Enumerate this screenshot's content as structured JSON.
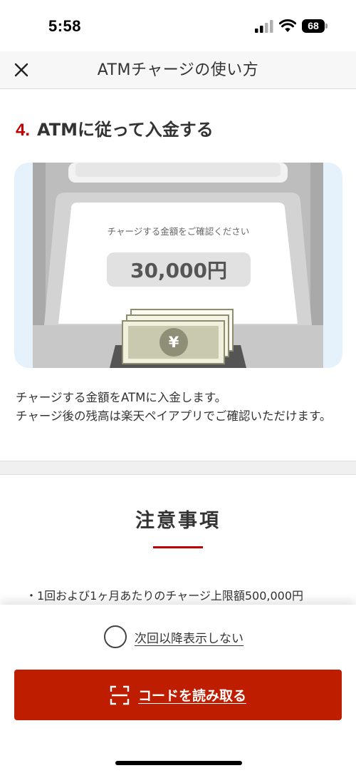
{
  "status_bar": {
    "time": "5:58",
    "battery": "68",
    "icons": [
      "signal-icon",
      "wifi-icon",
      "battery-icon"
    ]
  },
  "nav": {
    "title": "ATMチャージの使い方",
    "close_icon": "close-icon"
  },
  "step": {
    "number": "4.",
    "title": "ATMに従って入金する"
  },
  "illustration": {
    "screen_caption": "チャージする金額をご確認ください",
    "amount": "30,000円",
    "banknote_symbol": "¥"
  },
  "description": {
    "line1": "チャージする金額をATMに入金します。",
    "line2": "チャージ後の残高は楽天ペイアプリでご確認いただけます。"
  },
  "notes": {
    "heading": "注意事項",
    "items": [
      "・1回および1ヶ月あたりのチャージ上限額500,000円"
    ]
  },
  "bottom_sheet": {
    "dont_show_label": "次回以降表示しない",
    "scan_button_label": "コードを読み取る",
    "scan_icon": "scan-frame-icon"
  },
  "colors": {
    "accent": "#bf0000",
    "button": "#bf1d00",
    "illustration_bg": "#e6f2fb"
  }
}
